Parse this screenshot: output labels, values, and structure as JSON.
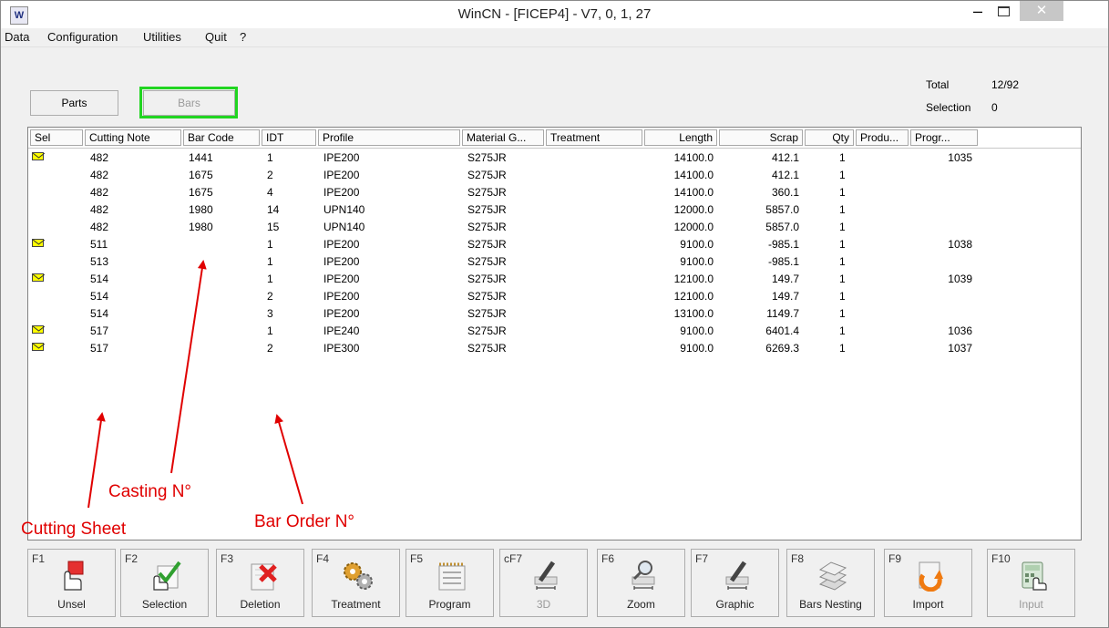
{
  "window": {
    "title": "WinCN - [FICEP4] - V7, 0, 1, 27",
    "app_icon_letter": "W",
    "controls": {
      "minimize": "‒",
      "close": "✕"
    }
  },
  "menu": [
    {
      "label": "Data"
    },
    {
      "label": "Configuration"
    },
    {
      "label": "Utilities"
    },
    {
      "label": "Quit"
    },
    {
      "label": "?"
    }
  ],
  "toolbar": {
    "parts_label": "Parts",
    "bars_label": "Bars"
  },
  "totals": {
    "total_label": "Total",
    "total_value": "12/92",
    "selection_label": "Selection",
    "selection_value": "0"
  },
  "table": {
    "columns": [
      "Sel",
      "Cutting Note",
      "Bar Code",
      "IDT",
      "Profile",
      "Material G...",
      "Treatment",
      "Length",
      "Scrap",
      "Qty",
      "Produ...",
      "Progr..."
    ],
    "rows": [
      {
        "sel": true,
        "cutting_note": "482",
        "bar_code": "1441",
        "idt": "1",
        "profile": "IPE200",
        "material": "S275JR",
        "treatment": "",
        "length": "14100.0",
        "scrap": "412.1",
        "qty": "1",
        "produ": "",
        "progr": "1035"
      },
      {
        "sel": false,
        "cutting_note": "482",
        "bar_code": "1675",
        "idt": "2",
        "profile": "IPE200",
        "material": "S275JR",
        "treatment": "",
        "length": "14100.0",
        "scrap": "412.1",
        "qty": "1",
        "produ": "",
        "progr": ""
      },
      {
        "sel": false,
        "cutting_note": "482",
        "bar_code": "1675",
        "idt": "4",
        "profile": "IPE200",
        "material": "S275JR",
        "treatment": "",
        "length": "14100.0",
        "scrap": "360.1",
        "qty": "1",
        "produ": "",
        "progr": ""
      },
      {
        "sel": false,
        "cutting_note": "482",
        "bar_code": "1980",
        "idt": "14",
        "profile": "UPN140",
        "material": "S275JR",
        "treatment": "",
        "length": "12000.0",
        "scrap": "5857.0",
        "qty": "1",
        "produ": "",
        "progr": ""
      },
      {
        "sel": false,
        "cutting_note": "482",
        "bar_code": "1980",
        "idt": "15",
        "profile": "UPN140",
        "material": "S275JR",
        "treatment": "",
        "length": "12000.0",
        "scrap": "5857.0",
        "qty": "1",
        "produ": "",
        "progr": ""
      },
      {
        "sel": true,
        "cutting_note": "511",
        "bar_code": "",
        "idt": "1",
        "profile": "IPE200",
        "material": "S275JR",
        "treatment": "",
        "length": "9100.0",
        "scrap": "-985.1",
        "qty": "1",
        "produ": "",
        "progr": "1038"
      },
      {
        "sel": false,
        "cutting_note": "513",
        "bar_code": "",
        "idt": "1",
        "profile": "IPE200",
        "material": "S275JR",
        "treatment": "",
        "length": "9100.0",
        "scrap": "-985.1",
        "qty": "1",
        "produ": "",
        "progr": ""
      },
      {
        "sel": true,
        "cutting_note": "514",
        "bar_code": "",
        "idt": "1",
        "profile": "IPE200",
        "material": "S275JR",
        "treatment": "",
        "length": "12100.0",
        "scrap": "149.7",
        "qty": "1",
        "produ": "",
        "progr": "1039"
      },
      {
        "sel": false,
        "cutting_note": "514",
        "bar_code": "",
        "idt": "2",
        "profile": "IPE200",
        "material": "S275JR",
        "treatment": "",
        "length": "12100.0",
        "scrap": "149.7",
        "qty": "1",
        "produ": "",
        "progr": ""
      },
      {
        "sel": false,
        "cutting_note": "514",
        "bar_code": "",
        "idt": "3",
        "profile": "IPE200",
        "material": "S275JR",
        "treatment": "",
        "length": "13100.0",
        "scrap": "1149.7",
        "qty": "1",
        "produ": "",
        "progr": ""
      },
      {
        "sel": true,
        "cutting_note": "517",
        "bar_code": "",
        "idt": "1",
        "profile": "IPE240",
        "material": "S275JR",
        "treatment": "",
        "length": "9100.0",
        "scrap": "6401.4",
        "qty": "1",
        "produ": "",
        "progr": "1036"
      },
      {
        "sel": true,
        "cutting_note": "517",
        "bar_code": "",
        "idt": "2",
        "profile": "IPE300",
        "material": "S275JR",
        "treatment": "",
        "length": "9100.0",
        "scrap": "6269.3",
        "qty": "1",
        "produ": "",
        "progr": "1037"
      }
    ]
  },
  "annotations": {
    "casting": "Casting N°",
    "cutting_sheet": "Cutting Sheet",
    "bar_order": "Bar Order N°",
    "color": "#e00000"
  },
  "function_keys": [
    {
      "key": "F1",
      "label": "Unsel",
      "icon": "unselect-hand-icon",
      "enabled": true
    },
    {
      "key": "F2",
      "label": "Selection",
      "icon": "select-check-icon",
      "enabled": true
    },
    {
      "key": "F3",
      "label": "Deletion",
      "icon": "delete-x-icon",
      "enabled": true
    },
    {
      "key": "F4",
      "label": "Treatment",
      "icon": "gears-icon",
      "enabled": true
    },
    {
      "key": "F5",
      "label": "Program",
      "icon": "program-list-icon",
      "enabled": true
    },
    {
      "key": "cF7",
      "label": "3D",
      "icon": "pencil-ruler-icon",
      "enabled": false
    },
    {
      "key": "F6",
      "label": "Zoom",
      "icon": "magnifier-icon",
      "enabled": true
    },
    {
      "key": "F7",
      "label": "Graphic",
      "icon": "pencil-ruler-icon",
      "enabled": true
    },
    {
      "key": "F8",
      "label": "Bars Nesting",
      "icon": "stacked-bars-icon",
      "enabled": true
    },
    {
      "key": "F9",
      "label": "Import",
      "icon": "import-arrow-icon",
      "enabled": true
    },
    {
      "key": "F10",
      "label": "Input",
      "icon": "calculator-icon",
      "enabled": false
    }
  ],
  "colors": {
    "bars_highlight": "#21d521",
    "envelope": "#ffff00"
  }
}
